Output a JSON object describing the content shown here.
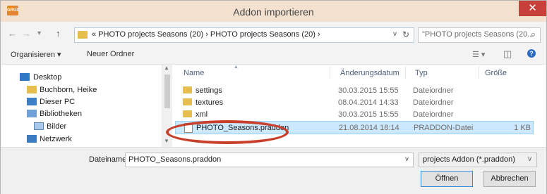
{
  "window": {
    "title": "Addon importieren",
    "app_icon_text": "GRUP",
    "close_glyph": "✕"
  },
  "nav": {
    "back_glyph": "←",
    "forward_glyph": "→",
    "recent_glyph": "▾",
    "up_glyph": "↑",
    "breadcrumb": "« PHOTO projects Seasons (20)  ›  PHOTO projects Seasons (20)  ›",
    "address_dropdown_glyph": "v",
    "refresh_glyph": "↻",
    "search_placeholder": "\"PHOTO projects Seasons (20... ",
    "search_glyph": "⌕"
  },
  "toolbar": {
    "organize_label": "Organisieren ▾",
    "new_folder_label": "Neuer Ordner",
    "view_glyph": "☰ ▾",
    "pane_glyph": "◫",
    "help_glyph": "?"
  },
  "sidebar": {
    "items": [
      {
        "label": "Desktop",
        "icon": "desktop-icon"
      },
      {
        "label": "Buchborn, Heike",
        "icon": "user-folder-icon"
      },
      {
        "label": "Dieser PC",
        "icon": "computer-icon"
      },
      {
        "label": "Bibliotheken",
        "icon": "libraries-icon"
      },
      {
        "label": "Bilder",
        "icon": "pictures-icon"
      },
      {
        "label": "Netzwerk",
        "icon": "network-icon"
      }
    ]
  },
  "filelist": {
    "columns": [
      "Name",
      "Änderungsdatum",
      "Typ",
      "Größe"
    ],
    "rows": [
      {
        "name": "settings",
        "date": "30.03.2015 15:55",
        "type": "Dateiordner",
        "size": "",
        "kind": "folder"
      },
      {
        "name": "textures",
        "date": "08.04.2014 14:33",
        "type": "Dateiordner",
        "size": "",
        "kind": "folder"
      },
      {
        "name": "xml",
        "date": "30.03.2015 15:55",
        "type": "Dateiordner",
        "size": "",
        "kind": "folder"
      },
      {
        "name": "PHOTO_Seasons.praddon",
        "date": "21.08.2014 18:14",
        "type": "PRADDON-Datei",
        "size": "1 KB",
        "kind": "file"
      }
    ]
  },
  "footer": {
    "filename_label": "Dateiname:",
    "filename_value": "PHOTO_Seasons.praddon",
    "filter_value": "projects Addon (*.praddon)",
    "open_label": "Öffnen",
    "cancel_label": "Abbrechen"
  },
  "colors": {
    "titlebar": "#f3e0cf",
    "close_button": "#c7403a",
    "selection": "#cce8ff",
    "highlight_oval": "#c8402a",
    "folder": "#e7bd4d"
  }
}
